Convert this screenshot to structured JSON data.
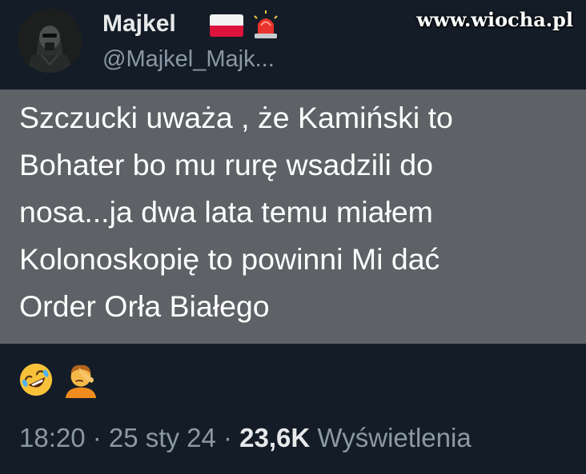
{
  "watermark": "www.wiocha.pl",
  "author": {
    "display_name": "Majkel",
    "handle": "@Majkel_Majk...",
    "avatar_icon": "masked-figure-avatar",
    "name_badges": [
      "poland-flag-icon",
      "police-siren-icon"
    ]
  },
  "tweet": {
    "lines": [
      "Szczucki uważa , że Kamiński to",
      "Bohater bo mu rurę wsadzili do",
      "nosa...ja dwa lata temu miałem",
      "Kolonoskopię to powinni Mi dać",
      "Order Orła Białego"
    ],
    "emojis": [
      "rolling-on-floor-laughing-icon",
      "person-facepalming-icon"
    ]
  },
  "meta": {
    "time": "18:20",
    "separator": " · ",
    "date": "25 sty 24",
    "views_count": "23,6K",
    "views_label": "Wyświetlenia"
  },
  "colors": {
    "background": "#141d27",
    "highlight": "#5e6165",
    "primary_text": "#e7e9ea",
    "secondary_text": "#8b98a5"
  }
}
